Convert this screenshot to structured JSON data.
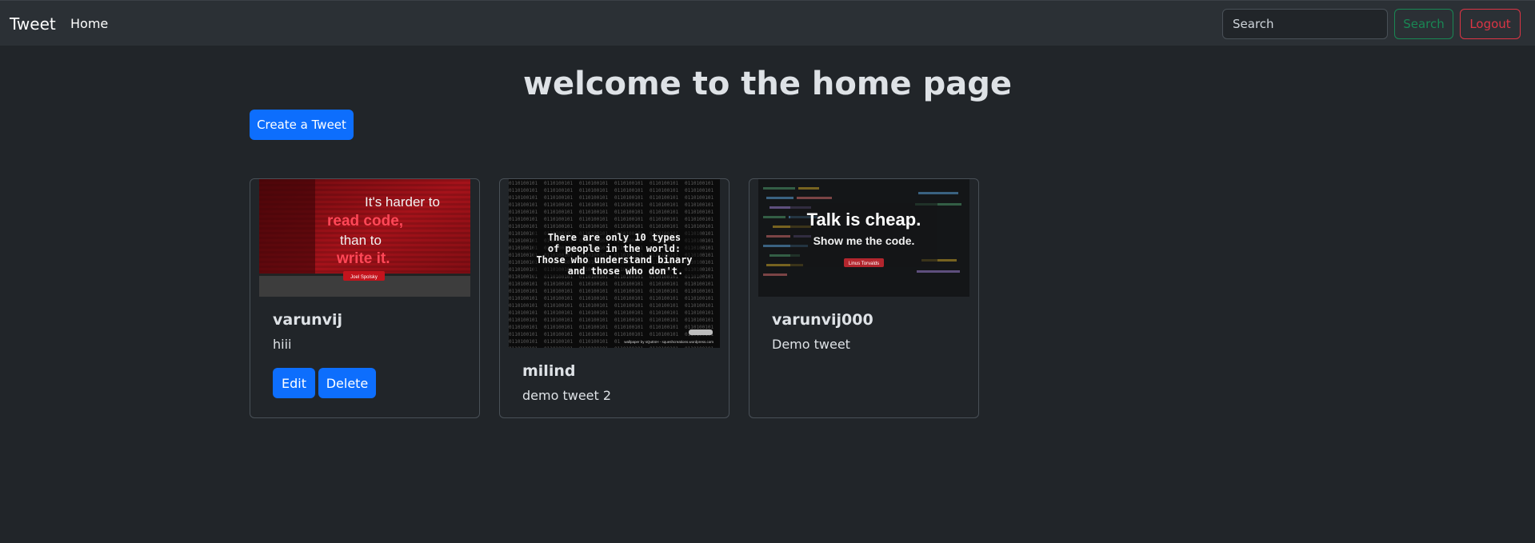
{
  "navbar": {
    "brand": "Tweet",
    "home_link": "Home",
    "search_placeholder": "Search",
    "search_button": "Search",
    "logout_button": "Logout"
  },
  "main": {
    "title": "welcome to the home page",
    "create_button": "Create a Tweet"
  },
  "tweets": [
    {
      "username": "varunvij",
      "text": "hiii",
      "edit_label": "Edit",
      "delete_label": "Delete",
      "image": {
        "line1": "It's harder to",
        "line2": "read code,",
        "line3": "than to",
        "line4": "write it.",
        "badge": "Joel Spolsky"
      }
    },
    {
      "username": "milind",
      "text": "demo tweet 2",
      "image": {
        "line1": "There are only 10 types",
        "line2": "of people in the world:",
        "line3": "Those who understand binary",
        "line4": "and those who don't.",
        "footer": "wallpaper by sQuEsH - squeshcreations.wordpress.com"
      }
    },
    {
      "username": "varunvij000",
      "text": "Demo tweet",
      "image": {
        "line1": "Talk is cheap.",
        "line2": "Show me the code.",
        "badge": "Linus Torvalds"
      }
    }
  ]
}
